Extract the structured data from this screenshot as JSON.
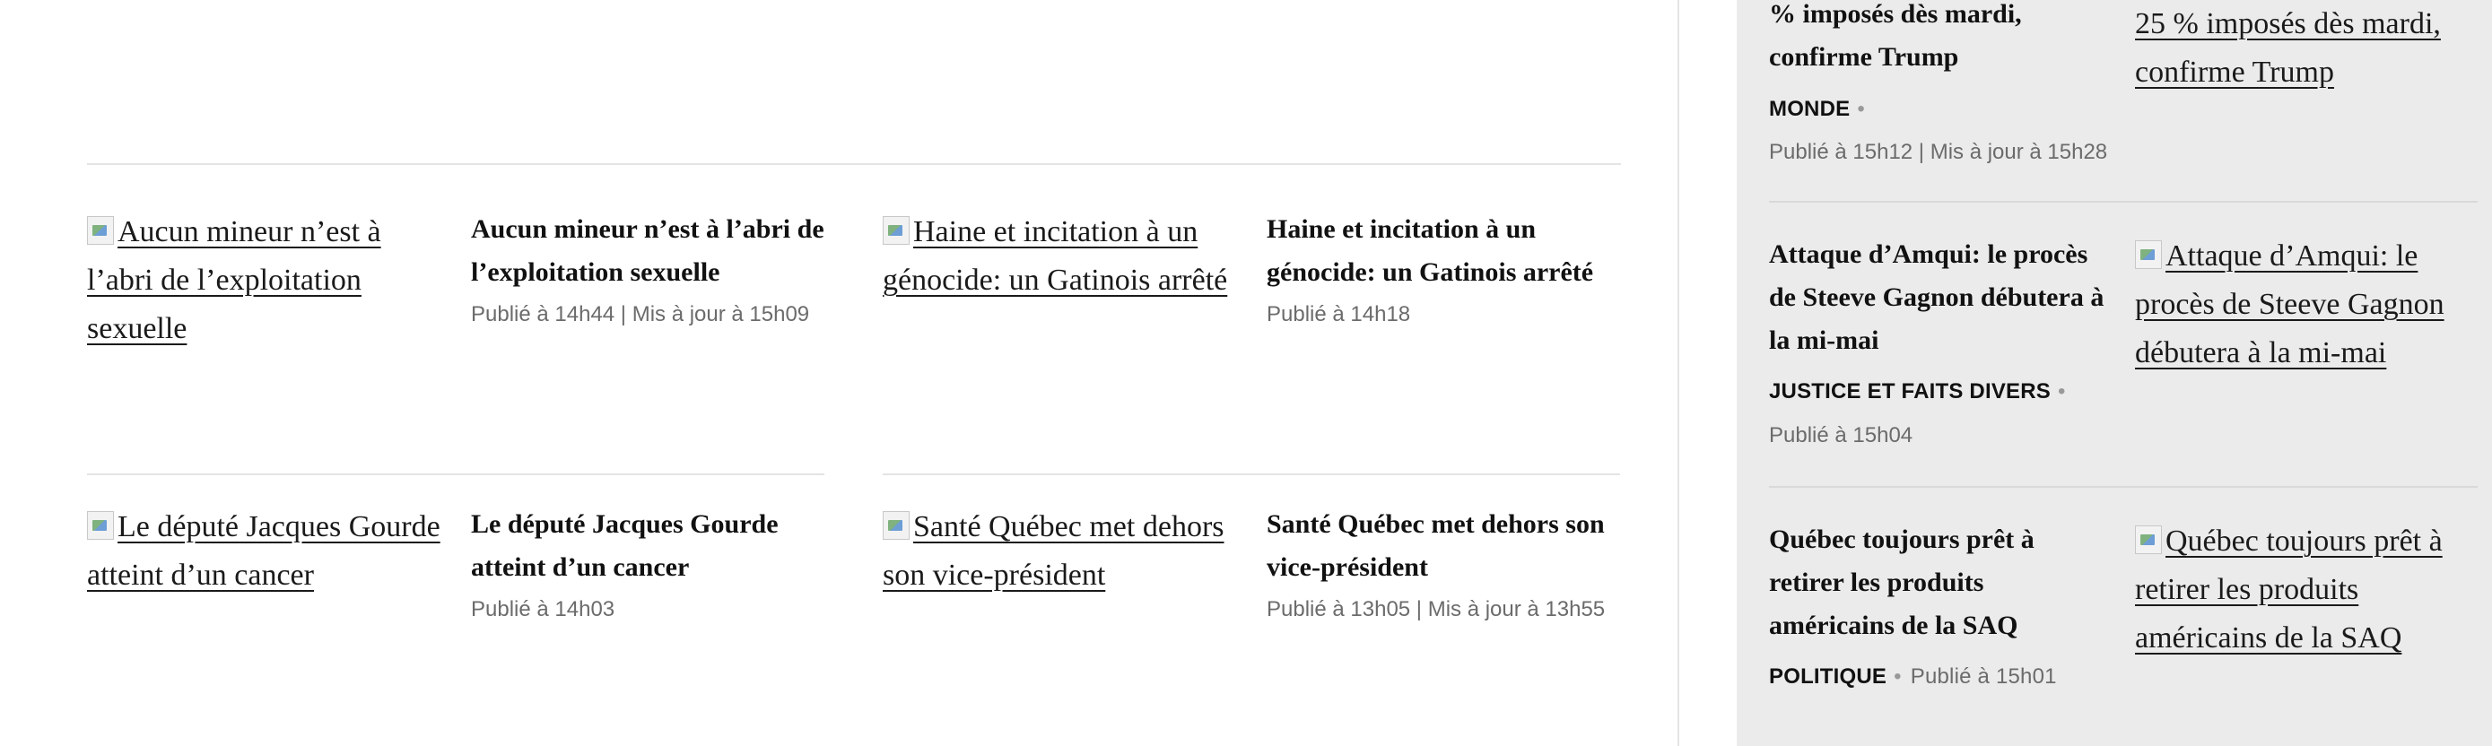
{
  "main": {
    "articles": [
      {
        "img_alt": "Aucun mineur n’est à l’abri de l’exploitation sexuelle",
        "title": "Aucun mineur n’est à l’abri de l’exploitation sexuelle",
        "meta": "Publié à 14h44 | Mis à jour à 15h09"
      },
      {
        "img_alt": "Haine et incitation à un génocide: un Gatinois arrêté",
        "title": "Haine et incitation à un génocide: un Gatinois arrêté",
        "meta": "Publié à 14h18"
      },
      {
        "img_alt": "Le député Jacques Gourde atteint d’un cancer",
        "title": "Le député Jacques Gourde atteint d’un cancer",
        "meta": "Publié à 14h03"
      },
      {
        "img_alt": "Santé Québec met dehors son vice-président",
        "title": "Santé Québec met dehors son vice-président",
        "meta": "Publié à 13h05 | Mis à jour à 13h55"
      }
    ]
  },
  "sidebar": {
    "items": [
      {
        "title": "% imposés dès mardi, confirme Trump",
        "img_alt": "25 % imposés dès mardi, confirme Trump",
        "category": "MONDE",
        "meta": "Publié à 15h12 | Mis à jour à 15h28"
      },
      {
        "title": "Attaque d’Amqui: le procès de Steeve Gagnon débutera à la mi-mai",
        "img_alt": "Attaque d’Amqui: le procès de Steeve Gagnon débutera à la mi-mai",
        "category": "JUSTICE ET FAITS DIVERS",
        "meta": "Publié à 15h04"
      },
      {
        "title": "Québec toujours prêt à retirer les produits américains de la SAQ",
        "img_alt": "Québec toujours prêt à retirer les produits américains de la SAQ",
        "category": "POLITIQUE",
        "meta": "Publié à 15h01"
      }
    ]
  }
}
